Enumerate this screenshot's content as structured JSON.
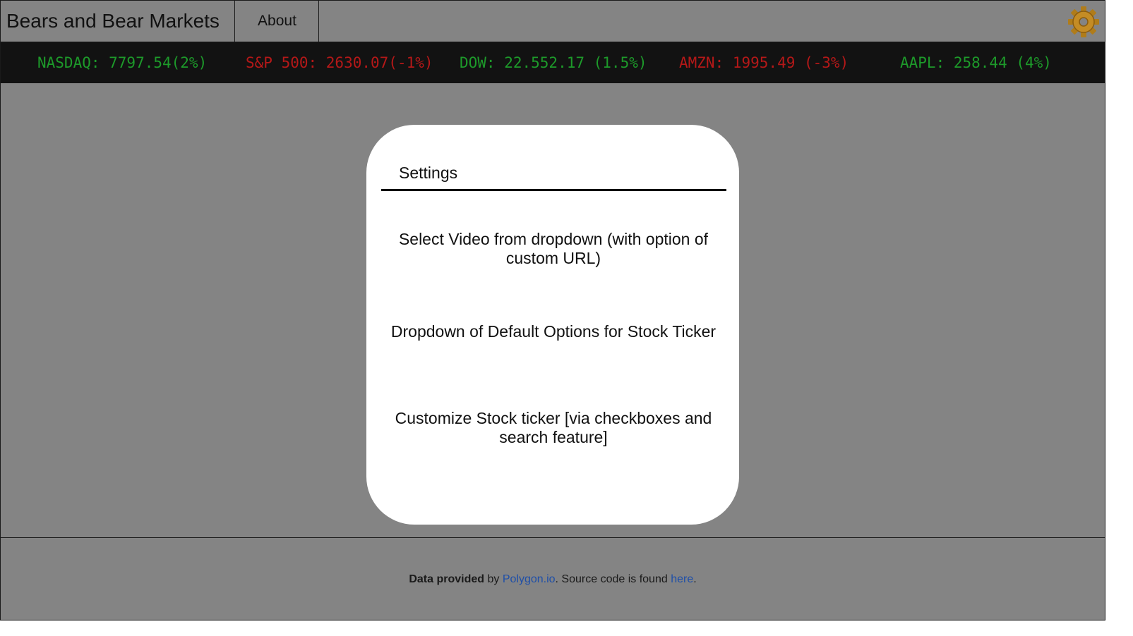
{
  "header": {
    "brand": "Bears and Bear Markets",
    "nav_about": "About",
    "settings_icon": "gear-icon"
  },
  "ticker": [
    {
      "text": "NASDAQ: 7797.54(2%)",
      "trend": "up"
    },
    {
      "text": "S&P 500: 2630.07(-1%)",
      "trend": "down"
    },
    {
      "text": "DOW: 22.552.17 (1.5%)",
      "trend": "up"
    },
    {
      "text": "AMZN: 1995.49 (-3%)",
      "trend": "down"
    },
    {
      "text": "AAPL: 258.44 (4%)",
      "trend": "up"
    }
  ],
  "colors": {
    "up": "#1d9a2a",
    "down": "#b51818",
    "link": "#1f4fa8"
  },
  "modal": {
    "title": "Settings",
    "items": [
      "Select Video from dropdown (with option of custom URL)",
      "Dropdown of Default Options for Stock Ticker",
      "Customize Stock ticker [via checkboxes and search feature]"
    ]
  },
  "footer": {
    "bold": "Data provided",
    "by": " by ",
    "provider_link": "Polygon.io",
    "middle": ". Source code is found ",
    "source_link": "here",
    "end": "."
  }
}
